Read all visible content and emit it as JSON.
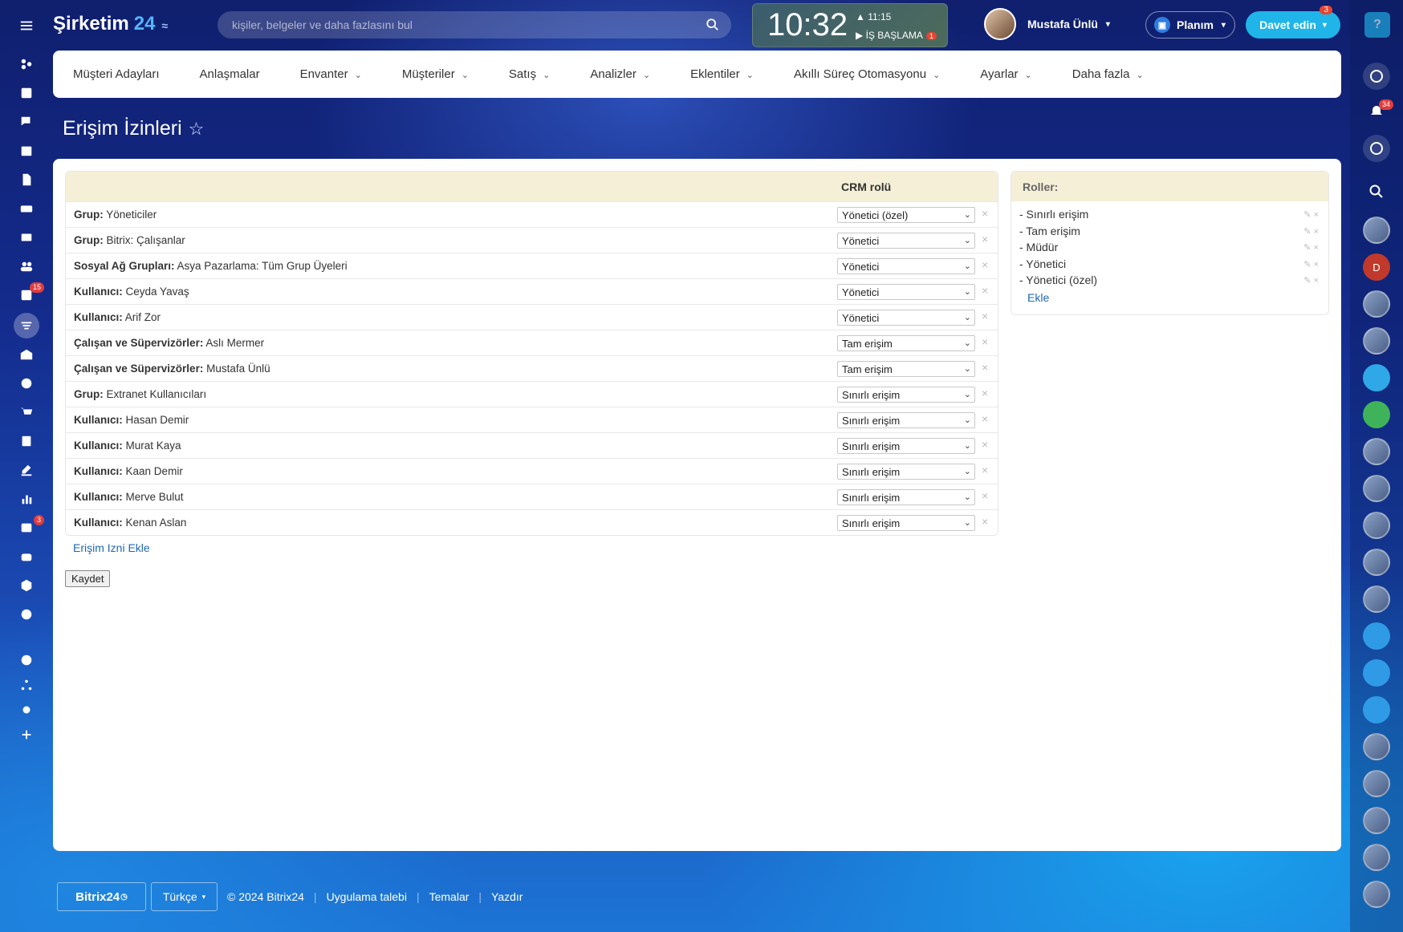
{
  "header": {
    "logo_text": "Şirketim",
    "logo_num": "24",
    "search_placeholder": "kişiler, belgeler ve daha fazlasını bul",
    "clock_time": "10:32",
    "clock_alarm": "11:15",
    "workday_label": "İŞ BAŞLAMA",
    "workday_badge": "1",
    "user_name": "Mustafa Ünlü",
    "plan_label": "Planım",
    "invite_label": "Davet edin",
    "invite_badge": "3",
    "help_label": "?"
  },
  "top_menu": [
    {
      "label": "Müşteri Adayları",
      "dropdown": false
    },
    {
      "label": "Anlaşmalar",
      "dropdown": false
    },
    {
      "label": "Envanter",
      "dropdown": true
    },
    {
      "label": "Müşteriler",
      "dropdown": true
    },
    {
      "label": "Satış",
      "dropdown": true
    },
    {
      "label": "Analizler",
      "dropdown": true
    },
    {
      "label": "Eklentiler",
      "dropdown": true
    },
    {
      "label": "Akıllı Süreç Otomasyonu",
      "dropdown": true
    },
    {
      "label": "Ayarlar",
      "dropdown": true
    },
    {
      "label": "Daha fazla",
      "dropdown": true
    }
  ],
  "page_title": "Erişim İzinleri",
  "permissions": {
    "column_header": "CRM rolü",
    "rows": [
      {
        "type": "Grup:",
        "name": "Yöneticiler",
        "role": "Yönetici (özel)"
      },
      {
        "type": "Grup:",
        "name": "Bitrix: Çalışanlar",
        "role": "Yönetici"
      },
      {
        "type": "Sosyal Ağ Grupları:",
        "name": "Asya Pazarlama: Tüm Grup Üyeleri",
        "role": "Yönetici"
      },
      {
        "type": "Kullanıcı:",
        "name": "Ceyda Yavaş",
        "role": "Yönetici"
      },
      {
        "type": "Kullanıcı:",
        "name": "Arif Zor",
        "role": "Yönetici"
      },
      {
        "type": "Çalışan ve Süpervizörler:",
        "name": "Aslı Mermer",
        "role": "Tam erişim"
      },
      {
        "type": "Çalışan ve Süpervizörler:",
        "name": "Mustafa Ünlü",
        "role": "Tam erişim"
      },
      {
        "type": "Grup:",
        "name": "Extranet Kullanıcıları",
        "role": "Sınırlı erişim"
      },
      {
        "type": "Kullanıcı:",
        "name": "Hasan Demir",
        "role": "Sınırlı erişim"
      },
      {
        "type": "Kullanıcı:",
        "name": "Murat Kaya",
        "role": "Sınırlı erişim"
      },
      {
        "type": "Kullanıcı:",
        "name": "Kaan Demir",
        "role": "Sınırlı erişim"
      },
      {
        "type": "Kullanıcı:",
        "name": "Merve Bulut",
        "role": "Sınırlı erişim"
      },
      {
        "type": "Kullanıcı:",
        "name": "Kenan Aslan",
        "role": "Sınırlı erişim"
      }
    ],
    "add_link": "Erişim Izni Ekle",
    "save_label": "Kaydet"
  },
  "roles": {
    "header": "Roller:",
    "items": [
      "- Sınırlı erişim",
      "- Tam erişim",
      "- Müdür",
      "- Yönetici",
      "- Yönetici (özel)"
    ],
    "add_label": "Ekle"
  },
  "footer": {
    "logo": "Bitrix24",
    "language": "Türkçe",
    "copyright": "© 2024 Bitrix24",
    "links": [
      "Uygulama talebi",
      "Temalar",
      "Yazdır"
    ]
  },
  "left_sidebar": {
    "icons": [
      "menu-icon",
      "activity-icon",
      "feed-icon",
      "chat-icon",
      "calendar-icon",
      "documents-icon",
      "drive-icon",
      "mail-icon",
      "groups-icon",
      "tasks-icon",
      "crm-icon",
      "company-icon",
      "sites-icon",
      "shop-icon",
      "forms-icon",
      "sign-icon",
      "analytics-icon",
      "contacts-icon",
      "robot-icon",
      "inventory-icon",
      "more-icon",
      "help-icon",
      "structure-icon",
      "settings-icon",
      "add-icon"
    ],
    "tasks_badge": "15",
    "contacts_badge": "3"
  },
  "right_sidebar": {
    "notifications_badge": "34",
    "avatar_initial": "D"
  },
  "colors": {
    "accent": "#1fb5e8",
    "link": "#2067b0",
    "table_header": "#f4efd6"
  }
}
